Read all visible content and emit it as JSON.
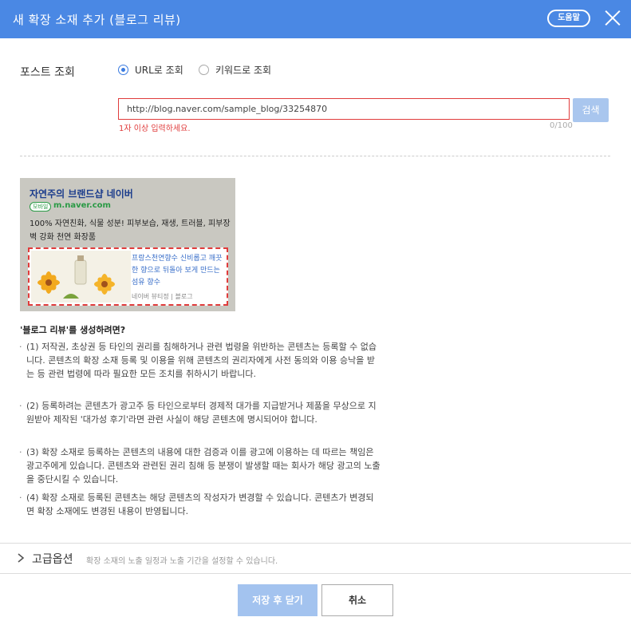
{
  "header": {
    "title": "새 확장 소재 추가 (블로그 리뷰)",
    "help_label": "도움말"
  },
  "post_lookup": {
    "label": "포스트 조회",
    "options": [
      "URL로 조회",
      "키워드로 조회"
    ],
    "selected": "URL로 조회",
    "url_value": "http://blog.naver.com/sample_blog/33254870",
    "search_label": "검색",
    "error": "1자 이상 입력하세요.",
    "char_count": "0/100"
  },
  "preview": {
    "title": "자연주의 브랜드샵 네이버",
    "badge": "모바일",
    "url": "m.naver.com",
    "description": "100% 자연친화, 식물 성분! 피부보습, 재생, 트러블, 피부장벽 강화 천연 화장품",
    "sub_text": "프랑스천연향수 신비롭고 깨끗한 향으로 뒤돌아 보게 만드는 섬유 향수",
    "source": "네이버 뷰티정",
    "source_type": "블로그"
  },
  "guide": {
    "title": "'블로그 리뷰'를 생성하려면?",
    "items": [
      "(1) 저작권, 초상권 등 타인의 권리를 침해하거나 관련 법령을 위반하는 콘텐츠는 등록할 수 없습니다. 콘텐츠의 확장 소재 등록 및 이용을 위해 콘텐츠의 권리자에게 사전 동의와 이용 승낙을 받는 등 관련 법령에 따라 필요한 모든 조치를 취하시기 바랍니다.",
      "(2) 등록하려는 콘텐츠가 광고주 등 타인으로부터 경제적 대가를 지급받거나 제품을 무상으로 지원받아 제작된 '대가성 후기'라면 관련 사실이 해당 콘텐츠에 명시되어야 합니다.",
      "(3) 확장 소재로 등록하는 콘텐츠의 내용에 대한 검증과 이를 광고에 이용하는 데 따르는 책임은 광고주에게 있습니다. 콘텐츠와 관련된 권리 침해 등 분쟁이 발생할 때는 회사가 해당 광고의 노출을 중단시킬 수 있습니다.",
      "(4) 확장 소재로 등록된 콘텐츠는 해당 콘텐츠의 작성자가 변경할 수 있습니다. 콘텐츠가 변경되면 확장 소재에도 변경된 내용이 반영됩니다."
    ]
  },
  "advanced": {
    "label": "고급옵션",
    "description": "확장 소재의 노출 일정과 노출 기간을 설정할 수 있습니다."
  },
  "footer": {
    "save_label": "저장 후 닫기",
    "cancel_label": "취소"
  }
}
